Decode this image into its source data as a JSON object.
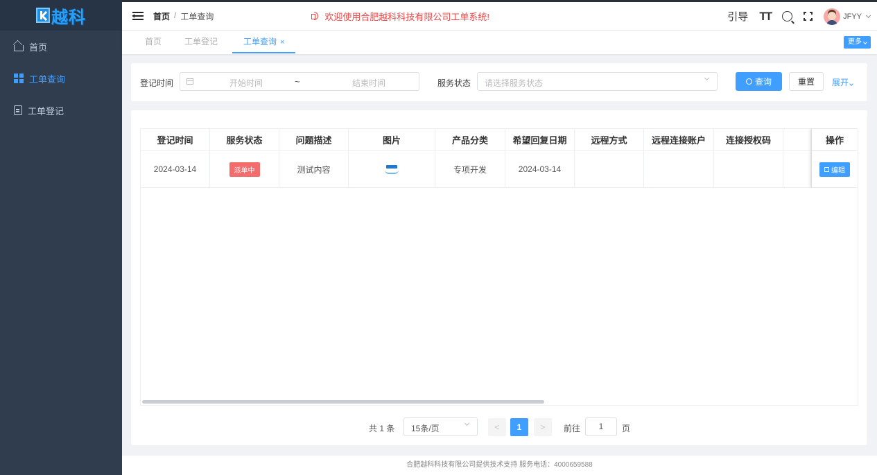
{
  "logo": {
    "text": "越科"
  },
  "sidebar": {
    "items": [
      {
        "label": "首页",
        "icon": "home-icon",
        "active": false
      },
      {
        "label": "工单查询",
        "icon": "grid-icon",
        "active": true
      },
      {
        "label": "工单登记",
        "icon": "document-icon",
        "active": false
      }
    ]
  },
  "header": {
    "breadcrumb_home": "首页",
    "breadcrumb_sep": "/",
    "breadcrumb_current": "工单查询",
    "notice": "欢迎使用合肥越科科技有限公司工单系统!",
    "guide": "引导",
    "font_size_icon": "TT",
    "username": "JFYY"
  },
  "tabs": {
    "items": [
      {
        "label": "首页"
      },
      {
        "label": "工单登记"
      },
      {
        "label": "工单查询",
        "close": "×"
      }
    ],
    "more": "更多"
  },
  "filter": {
    "date_label": "登记时间",
    "start_placeholder": "开始时间",
    "range_sep": "~",
    "end_placeholder": "结束时间",
    "status_label": "服务状态",
    "status_placeholder": "请选择服务状态",
    "query": "查询",
    "reset": "重置",
    "expand": "展开"
  },
  "table": {
    "columns": [
      "登记时间",
      "服务状态",
      "问题描述",
      "图片",
      "产品分类",
      "希望回复日期",
      "远程方式",
      "远程连接账户",
      "连接授权码",
      "",
      "操作"
    ],
    "rows": [
      {
        "date": "2024-03-14",
        "status": "派单中",
        "desc": "测试内容",
        "product": "专项开发",
        "reply_date": "2024-03-14",
        "remote": "",
        "account": "",
        "auth_code": "",
        "edit": "编辑"
      }
    ]
  },
  "pager": {
    "total": "共 1 条",
    "page_size": "15条/页",
    "prev": "<",
    "current": "1",
    "next": ">",
    "goto": "前往",
    "goto_value": "1",
    "page_unit": "页"
  },
  "footer": {
    "text": "合肥越科科技有限公司提供技术支持 服务电话：4000659588"
  },
  "colors": {
    "primary": "#409eff",
    "sidebar": "#2f3d4f",
    "danger": "#f56c6c",
    "notice": "#f04545"
  }
}
